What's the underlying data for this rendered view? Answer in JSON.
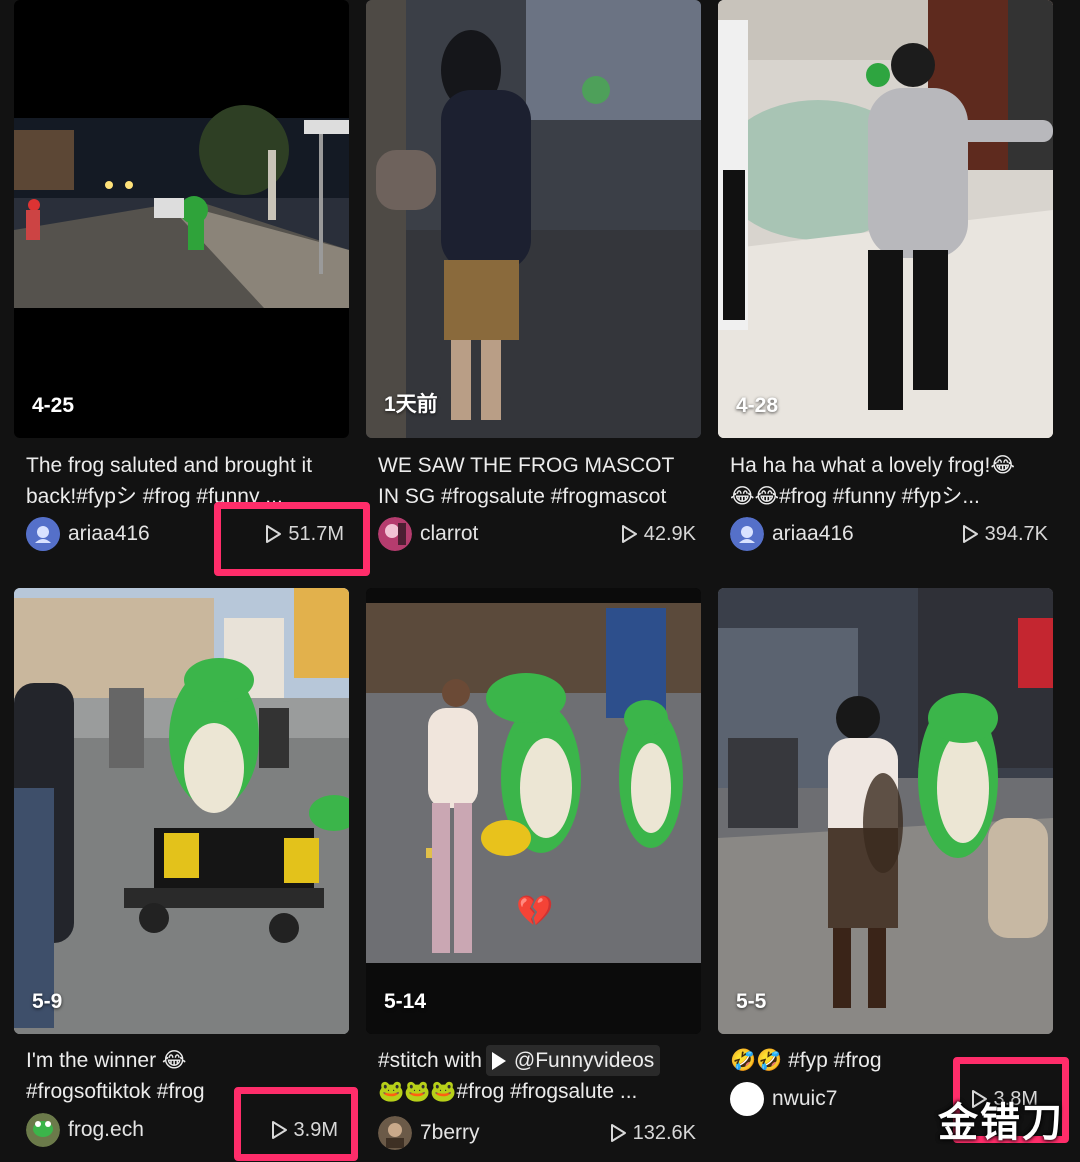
{
  "videos": [
    {
      "date": "4-25",
      "caption_lines": [
        "The frog saluted and brought it",
        "back!#fypシ #frog #funny ..."
      ],
      "user": "ariaa416",
      "views": "51.7M"
    },
    {
      "date": "1天前",
      "caption_lines": [
        "WE SAW THE FROG MASCOT",
        "IN SG #frogsalute #frogmascot"
      ],
      "user": "clarrot",
      "views": "42.9K"
    },
    {
      "date": "4-28",
      "caption_lines": [
        "Ha ha ha what a lovely frog!😂",
        "😂😂#frog #funny #fypシ..."
      ],
      "user": "ariaa416",
      "views": "394.7K"
    },
    {
      "date": "5-9",
      "caption_lines": [
        "I'm the winner 😂",
        "#frogsoftiktok #frog"
      ],
      "user": "frog.ech",
      "views": "3.9M"
    },
    {
      "date": "5-14",
      "caption_prefix": "#stitch with",
      "mention": "@Funnyvideos",
      "caption_lines": [
        "🐸🐸🐸#frog #frogsalute ..."
      ],
      "user": "7berry",
      "views": "132.6K",
      "overlay_emoji": "💔"
    },
    {
      "date": "5-5",
      "caption_lines": [
        "🤣🤣 #fyp #frog"
      ],
      "user": "nwuic7",
      "views": "3.8M"
    }
  ],
  "watermark": "金错刀",
  "icons": {
    "views": "play-outline-icon",
    "mention": "play-triangle-icon"
  },
  "colors": {
    "background": "#121212",
    "highlight": "#ff2d6a"
  }
}
